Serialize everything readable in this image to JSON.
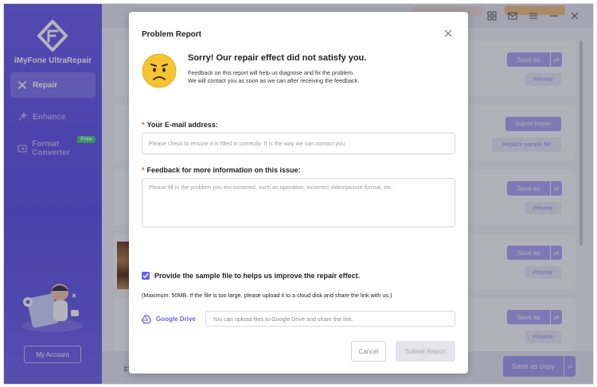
{
  "app": {
    "name": "iMyFone UltraRepair",
    "account_label": "My Account"
  },
  "sidebar": {
    "items": [
      {
        "label": "Repair",
        "icon": "repair-icon",
        "active": true
      },
      {
        "label": "Enhance",
        "icon": "enhance-icon",
        "active": false
      },
      {
        "label": "Format Converter",
        "icon": "format-converter-icon",
        "active": false
      }
    ],
    "free_badge": "Free"
  },
  "background_list": {
    "save_as_label": "Save as",
    "preview_label": "Preview",
    "submit_report_label": "Submit Report",
    "replace_sample_label": "Replace sample file",
    "save_as_copy_label": "Save as copy"
  },
  "dialog": {
    "title": "Problem Report",
    "headline": "Sorry! Our repair effect did not satisfy you.",
    "subtext_line1": "Feedback on this report will help us diagnose and fix the problem.",
    "subtext_line2": "We will contact you as soon as we can after receiving the feedback.",
    "email_label": "Your E-mail address:",
    "email_placeholder": "Please check to ensure it is filled in correctly. It is the way we can contact you.",
    "email_value": "",
    "feedback_label": "Feedback for more information on this issue:",
    "feedback_placeholder": "Please fill in the problem you encountered, such as operation, incorrect video/picture format, etc.",
    "feedback_value": "",
    "required_marker": "*",
    "sample_checkbox_checked": true,
    "sample_checkbox_label": "Provide the sample file to helps us improve the repair effect.",
    "max_note": "(Maximum: 50MB. If the file is too large, please upload it to a cloud disk and share the link with us.)",
    "drive_label": "Google Drive",
    "drive_placeholder": "You can upload files to Google Drive and share the link.",
    "cancel_label": "Cancel",
    "submit_label": "Submit Report"
  },
  "colors": {
    "accent": "#6c5ff1",
    "sidebar": "#5a4fe6",
    "required": "#e05a2c",
    "emoji": "#f5c431"
  }
}
